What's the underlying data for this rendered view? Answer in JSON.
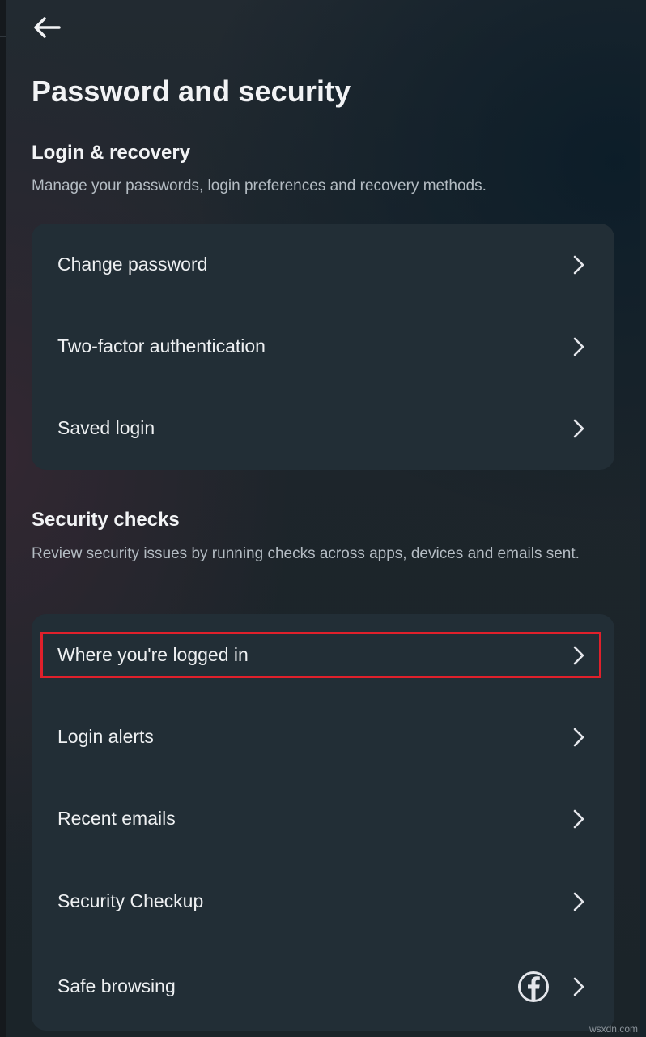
{
  "header": {
    "back_icon": "arrow-left-icon",
    "title": "Password and security"
  },
  "login_recovery": {
    "title": "Login & recovery",
    "description": "Manage your passwords, login preferences and recovery methods.",
    "items": [
      {
        "label": "Change password"
      },
      {
        "label": "Two-factor authentication"
      },
      {
        "label": "Saved login"
      }
    ]
  },
  "security_checks": {
    "title": "Security checks",
    "description": "Review security issues by running checks across apps, devices and emails sent.",
    "items": [
      {
        "label": "Where you're logged in",
        "highlighted": true
      },
      {
        "label": "Login alerts"
      },
      {
        "label": "Recent emails"
      },
      {
        "label": "Security Checkup"
      },
      {
        "label": "Safe browsing",
        "extra_icon": "facebook-icon"
      }
    ]
  },
  "highlight_color": "#e0202b",
  "watermark": "wsxdn.com"
}
